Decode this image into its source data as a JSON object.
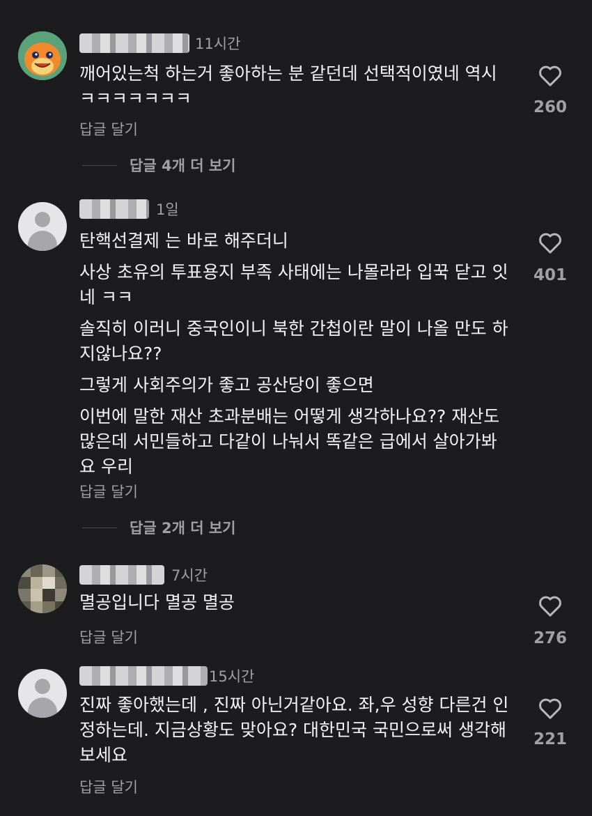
{
  "comments": [
    {
      "time": "11시간",
      "paragraphs": [
        "깨어있는척 하는거 좋아하는 분 같던데 선택적이였네 역시 ㅋㅋㅋㅋㅋㅋㅋ"
      ],
      "likes": "260",
      "reply_label": "답글 달기",
      "view_replies": "답글 4개 더 보기",
      "avatar": "character-avatar"
    },
    {
      "time": "1일",
      "paragraphs": [
        "탄핵선결제 는 바로 해주더니",
        "사상 초유의 투표용지 부족 사태에는 나몰라라 입꾹 닫고 잇네 ㅋㅋ",
        "솔직히 이러니 중국인이니 북한 간첩이란 말이 나올 만도 하지않나요??",
        "그렇게 사회주의가 좋고 공산당이 좋으면",
        "이번에 말한 재산 초과분배는 어떻게 생각하나요?? 재산도 많은데 서민들하고 다같이 나눠서 똑같은 급에서 살아가봐요 우리"
      ],
      "likes": "401",
      "reply_label": "답글 달기",
      "view_replies": "답글 2개 더 보기",
      "avatar": "default-avatar"
    },
    {
      "time": "7시간",
      "paragraphs": [
        "멸공입니다 멸공 멸공"
      ],
      "likes": "276",
      "reply_label": "답글 달기",
      "avatar": "pixelated-avatar"
    },
    {
      "time": "15시간",
      "paragraphs": [
        "진짜 좋아했는데 , 진짜 아닌거같아요. 좌,우 성향 다른건 인정하는데. 지금상황도 맞아요? 대한민국 국민으로써 생각해보세요"
      ],
      "likes": "221",
      "reply_label": "답글 달기",
      "avatar": "default-avatar"
    }
  ],
  "colors": {
    "background": "#1c1c1e",
    "text": "#f4f4f4",
    "muted": "#a0a0a5"
  }
}
